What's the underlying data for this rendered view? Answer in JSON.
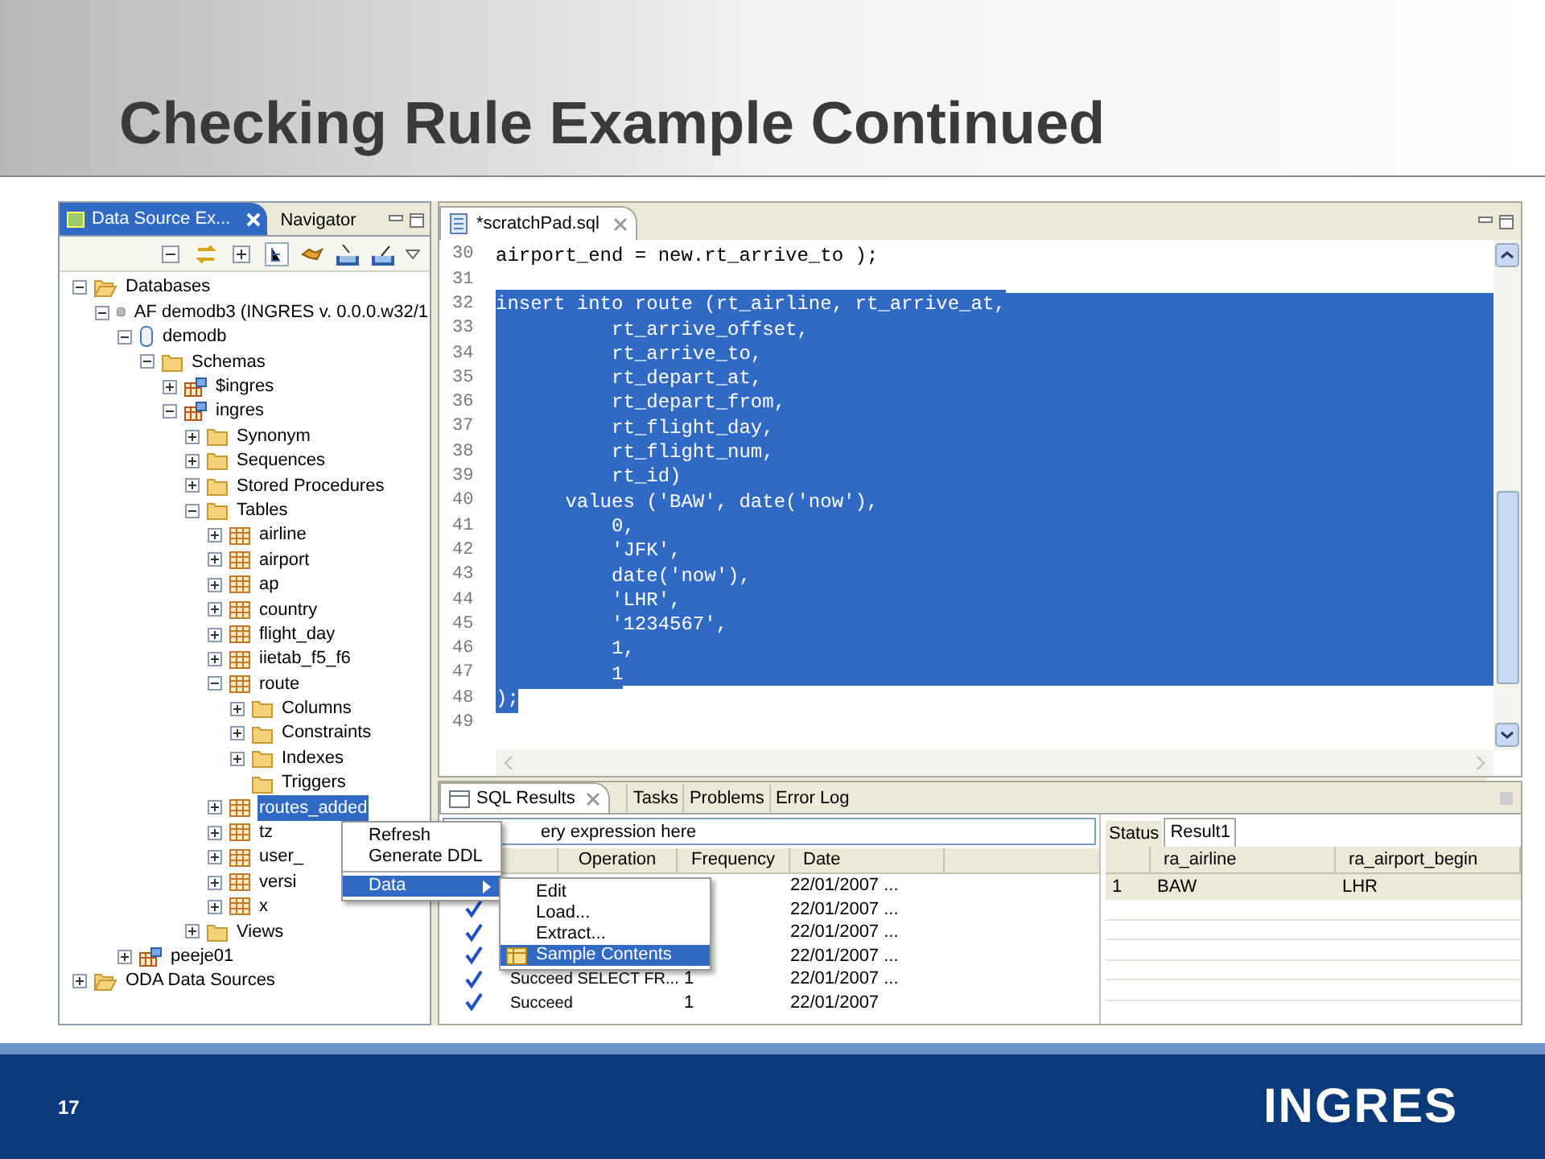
{
  "slide": {
    "title": "Checking Rule Example Continued",
    "page_number": "17",
    "logo": "INGRES"
  },
  "explorer": {
    "tabs": [
      {
        "label": "Data Source Ex...",
        "selected": true
      },
      {
        "label": "Navigator",
        "selected": false
      }
    ],
    "tree": [
      {
        "label": "Databases",
        "kind": "folder-open",
        "expanded": true,
        "selected": false,
        "children": [
          {
            "label": "AF demodb3 (INGRES v. 0.0.0.w32/1",
            "kind": "server",
            "expanded": true,
            "selected": false,
            "children": [
              {
                "label": "demodb",
                "kind": "database",
                "expanded": true,
                "selected": false,
                "children": [
                  {
                    "label": "Schemas",
                    "kind": "folder",
                    "expanded": true,
                    "selected": false,
                    "children": [
                      {
                        "label": "$ingres",
                        "kind": "schema",
                        "expanded": false,
                        "selected": false
                      },
                      {
                        "label": "ingres",
                        "kind": "schema",
                        "expanded": true,
                        "selected": false,
                        "children": [
                          {
                            "label": "Synonym",
                            "kind": "folder",
                            "expanded": false,
                            "selected": false
                          },
                          {
                            "label": "Sequences",
                            "kind": "folder",
                            "expanded": false,
                            "selected": false
                          },
                          {
                            "label": "Stored Procedures",
                            "kind": "folder",
                            "expanded": false,
                            "selected": false
                          },
                          {
                            "label": "Tables",
                            "kind": "folder",
                            "expanded": true,
                            "selected": false,
                            "children": [
                              {
                                "label": "airline",
                                "kind": "table",
                                "expanded": false,
                                "selected": false
                              },
                              {
                                "label": "airport",
                                "kind": "table",
                                "expanded": false,
                                "selected": false
                              },
                              {
                                "label": "ap",
                                "kind": "table",
                                "expanded": false,
                                "selected": false
                              },
                              {
                                "label": "country",
                                "kind": "table",
                                "expanded": false,
                                "selected": false
                              },
                              {
                                "label": "flight_day",
                                "kind": "table",
                                "expanded": false,
                                "selected": false
                              },
                              {
                                "label": "iietab_f5_f6",
                                "kind": "table",
                                "expanded": false,
                                "selected": false
                              },
                              {
                                "label": "route",
                                "kind": "table",
                                "expanded": true,
                                "selected": false,
                                "children": [
                                  {
                                    "label": "Columns",
                                    "kind": "folder",
                                    "expanded": false,
                                    "selected": false
                                  },
                                  {
                                    "label": "Constraints",
                                    "kind": "folder",
                                    "expanded": false,
                                    "selected": false
                                  },
                                  {
                                    "label": "Indexes",
                                    "kind": "folder",
                                    "expanded": false,
                                    "selected": false
                                  },
                                  {
                                    "label": "Triggers",
                                    "kind": "empty-folder",
                                    "selected": false
                                  }
                                ]
                              },
                              {
                                "label": "routes_added",
                                "kind": "table",
                                "expanded": false,
                                "selected": true
                              },
                              {
                                "label": "tz",
                                "kind": "table",
                                "expanded": false,
                                "selected": false
                              },
                              {
                                "label": "user_",
                                "kind": "table",
                                "expanded": false,
                                "selected": false
                              },
                              {
                                "label": "versi",
                                "kind": "table",
                                "expanded": false,
                                "selected": false
                              },
                              {
                                "label": "x",
                                "kind": "table",
                                "expanded": false,
                                "selected": false
                              }
                            ]
                          },
                          {
                            "label": "Views",
                            "kind": "folder",
                            "expanded": false,
                            "selected": false
                          }
                        ]
                      }
                    ]
                  }
                ]
              },
              {
                "label": "peeje01",
                "kind": "schema",
                "expanded": false,
                "selected": false
              }
            ]
          }
        ]
      },
      {
        "label": "ODA Data Sources",
        "kind": "folder-open",
        "expanded": false,
        "selected": false
      }
    ]
  },
  "editor": {
    "tab": "*scratchPad.sql",
    "lines": [
      {
        "num": "30",
        "text": "airport_end = new.rt_arrive_to );",
        "selected": false
      },
      {
        "num": "31",
        "selected": false
      },
      {
        "num": "32",
        "text": "insert into route (rt_airline, rt_arrive_at,",
        "selected": true
      },
      {
        "num": "33",
        "text": "          rt_arrive_offset,",
        "selected": true
      },
      {
        "num": "34",
        "text": "          rt_arrive_to,",
        "selected": true
      },
      {
        "num": "35",
        "text": "          rt_depart_at,",
        "selected": true
      },
      {
        "num": "36",
        "text": "          rt_depart_from,",
        "selected": true
      },
      {
        "num": "37",
        "text": "          rt_flight_day,",
        "selected": true
      },
      {
        "num": "38",
        "text": "          rt_flight_num,",
        "selected": true
      },
      {
        "num": "39",
        "text": "          rt_id)",
        "selected": true
      },
      {
        "num": "40",
        "text": "      values ('BAW', date('now'),",
        "selected": true
      },
      {
        "num": "41",
        "text": "          0,",
        "selected": true
      },
      {
        "num": "42",
        "text": "          'JFK',",
        "selected": true
      },
      {
        "num": "43",
        "text": "          date('now'),",
        "selected": true
      },
      {
        "num": "44",
        "text": "          'LHR',",
        "selected": true
      },
      {
        "num": "45",
        "text": "          '1234567',",
        "selected": true
      },
      {
        "num": "46",
        "text": "          1,",
        "selected": true
      },
      {
        "num": "47",
        "text": "          1",
        "selected": true
      },
      {
        "num": "48",
        "text": ");",
        "selected": true
      },
      {
        "num": "49",
        "selected": false
      }
    ]
  },
  "results": {
    "tabs": [
      {
        "label": "SQL Results",
        "selected": true
      },
      {
        "label": "Tasks",
        "selected": false
      },
      {
        "label": "Problems",
        "selected": false
      },
      {
        "label": "Error Log",
        "selected": false
      }
    ],
    "query_field": {
      "placeholder": "ery expression here"
    },
    "history": {
      "columns": [
        "Operation",
        "Frequency",
        "Date"
      ],
      "rows": [
        {
          "checked": false,
          "date": "22/01/2007 ..."
        },
        {
          "checked": true,
          "date": "22/01/2007 ..."
        },
        {
          "checked": true,
          "date": "22/01/2007 ..."
        },
        {
          "checked": true,
          "date": "22/01/2007 ..."
        },
        {
          "checked": true,
          "operation": "Succeed SELECT   FR...",
          "frequency": "1",
          "date": "22/01/2007 ..."
        },
        {
          "checked": true,
          "operation": "Succeed",
          "frequency": "1",
          "date": "22/01/2007"
        }
      ]
    },
    "result_tabs": [
      {
        "label": "Status",
        "selected": false
      },
      {
        "label": "Result1",
        "selected": true
      }
    ],
    "result_table": {
      "columns": [
        "ra_airline",
        "ra_airport_begin"
      ],
      "rows": [
        {
          "index": "1",
          "cells": [
            "BAW",
            "LHR"
          ]
        }
      ]
    }
  },
  "context_menu": {
    "items": [
      {
        "label": "Refresh",
        "selected": false,
        "submenu": false
      },
      {
        "label": "Generate DDL",
        "selected": false,
        "submenu": false
      },
      {
        "label": "Data",
        "selected": true,
        "submenu": true
      }
    ]
  },
  "submenu": {
    "items": [
      {
        "label": "Edit",
        "selected": false,
        "icon": false
      },
      {
        "label": "Load...",
        "selected": false,
        "icon": false
      },
      {
        "label": "Extract...",
        "selected": false,
        "icon": false
      },
      {
        "label": "Sample Contents",
        "selected": true,
        "icon": true
      }
    ]
  }
}
